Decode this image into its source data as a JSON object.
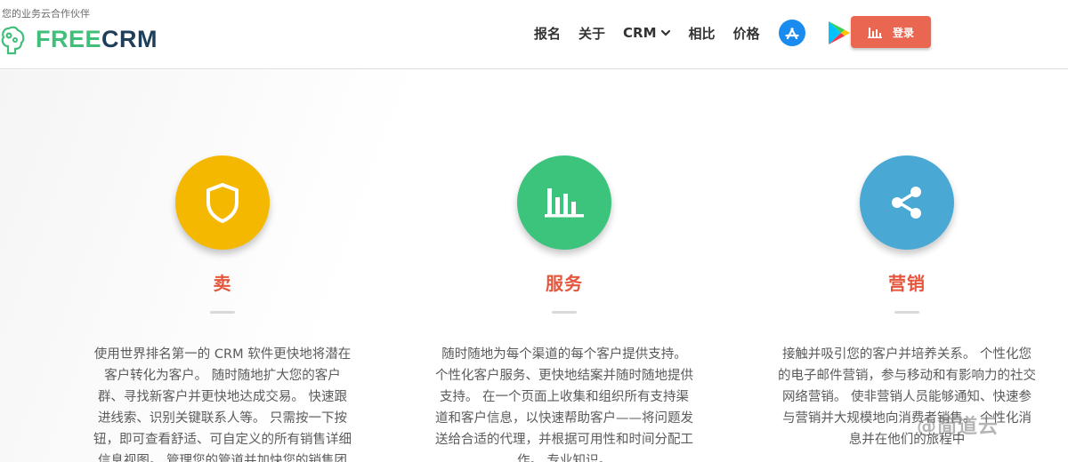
{
  "header": {
    "tagline": "您的业务云合作伙伴",
    "logo": {
      "part1": "FREE",
      "part2": "CRM"
    },
    "nav": [
      {
        "label": "报名"
      },
      {
        "label": "关于"
      },
      {
        "label": "CRM"
      },
      {
        "label": "相比"
      },
      {
        "label": "价格"
      }
    ],
    "app_store_icon": "app-store-icon",
    "google_play_icon": "google-play-icon",
    "login_label": "登录",
    "login_color": "#e96650"
  },
  "features": [
    {
      "icon": "shield-icon",
      "color": "#f5b800",
      "title": "卖",
      "lines": [
        "使用世界排名第一的 CRM 软件更快地将潜在",
        "客户转化为客户。 随时随地扩大您的客户",
        "群、寻找新客户并更快地达成交易。 快速跟",
        "进线索、识别关键联系人等。 只需按一下按",
        "钮，即可查看舒适、可自定义的所有销售详细",
        "信息视图。 管理您的管道并加快您的销售团"
      ]
    },
    {
      "icon": "bar-chart-icon",
      "color": "#3cc47c",
      "title": "服务",
      "lines": [
        "随时随地为每个渠道的每个客户提供支持。",
        "个性化客户服务、更快地结案并随时随地提供",
        "支持。 在一个页面上收集和组织所有支持渠",
        "道和客户信息，以快速帮助客户——将问题发",
        "送给合适的代理，并根据可用性和时间分配工",
        "作。 专业知识。"
      ]
    },
    {
      "icon": "share-icon",
      "color": "#4aa9d4",
      "title": "营销",
      "lines": [
        "接触并吸引您的客户并培养关系。 个性化您",
        "的电子邮件营销，参与移动和有影响力的社交",
        "网络营销。 使非营销人员能够通知、快速参",
        "与营销并大规模地向消费者销售。 个性化消",
        "息并在他们的旅程中"
      ]
    }
  ],
  "watermark": "@简道云"
}
